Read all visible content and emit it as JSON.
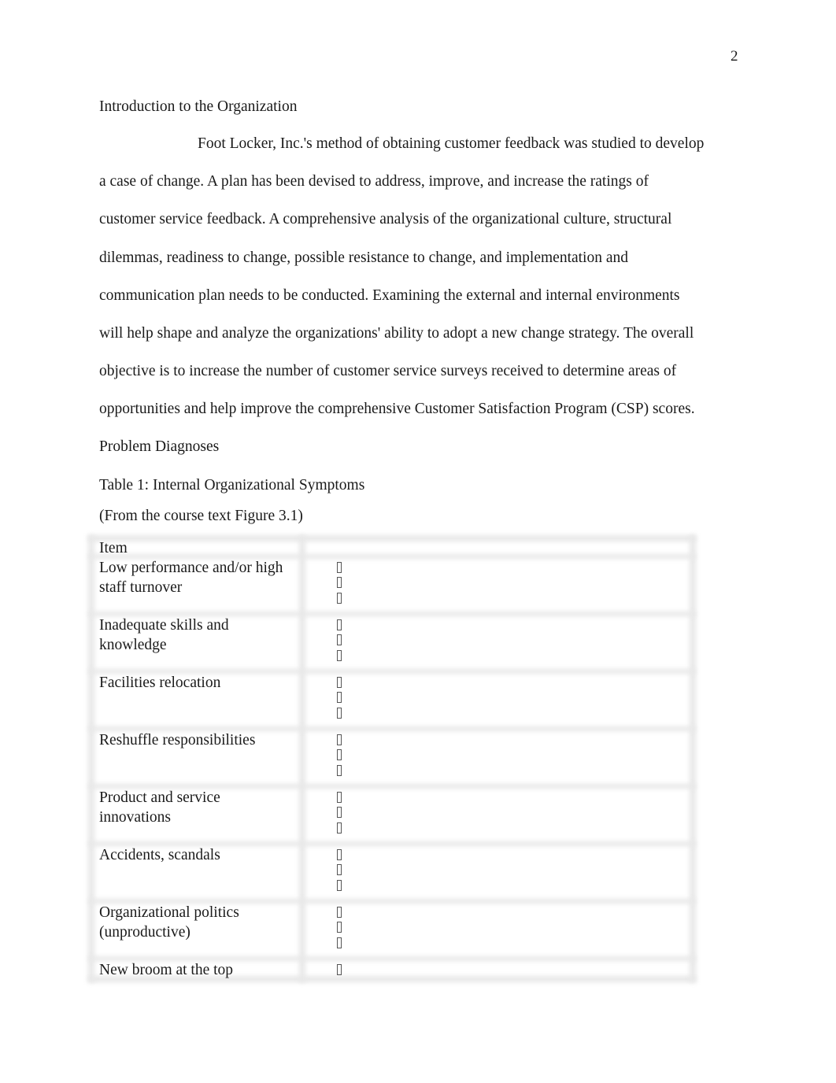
{
  "page": {
    "number": "2"
  },
  "section_intro": {
    "heading": "Introduction to the Organization",
    "lines": [
      "Foot Locker, Inc.'s method of obtaining customer feedback was studied to develop",
      "a case of change. A plan has been devised to address, improve, and increase the ratings of",
      "customer service feedback. A comprehensive analysis of the organizational culture, structural",
      "dilemmas, readiness to change, possible resistance to change, and implementation and",
      "communication plan needs to be conducted. Examining the external and internal environments",
      "will help shape and analyze the organizations' ability to adopt a new change strategy. The overall",
      "objective is to increase the number of customer service surveys received to determine areas of",
      "opportunities and help improve the comprehensive Customer Satisfaction Program (CSP) scores."
    ]
  },
  "section_problem": {
    "heading": "Problem Diagnoses",
    "table_caption": "Table 1: Internal Organizational Symptoms",
    "table_source": "(From the course text Figure 3.1)"
  },
  "table": {
    "header": {
      "item": "Item",
      "detail": ""
    },
    "bullet_icon": "missing-glyph-box",
    "rows": [
      {
        "item": "Low performance and/or high\nstaff turnover",
        "bullets": 3
      },
      {
        "item": "Inadequate skills and\nknowledge",
        "bullets": 3
      },
      {
        "item": "Facilities relocation",
        "bullets": 3
      },
      {
        "item": "Reshuffle responsibilities",
        "bullets": 3
      },
      {
        "item": "Product and service\ninnovations",
        "bullets": 3
      },
      {
        "item": "Accidents, scandals",
        "bullets": 3
      },
      {
        "item": "Organizational politics\n(unproductive)",
        "bullets": 3
      },
      {
        "item": "New broom at the top",
        "bullets": 1
      }
    ]
  }
}
